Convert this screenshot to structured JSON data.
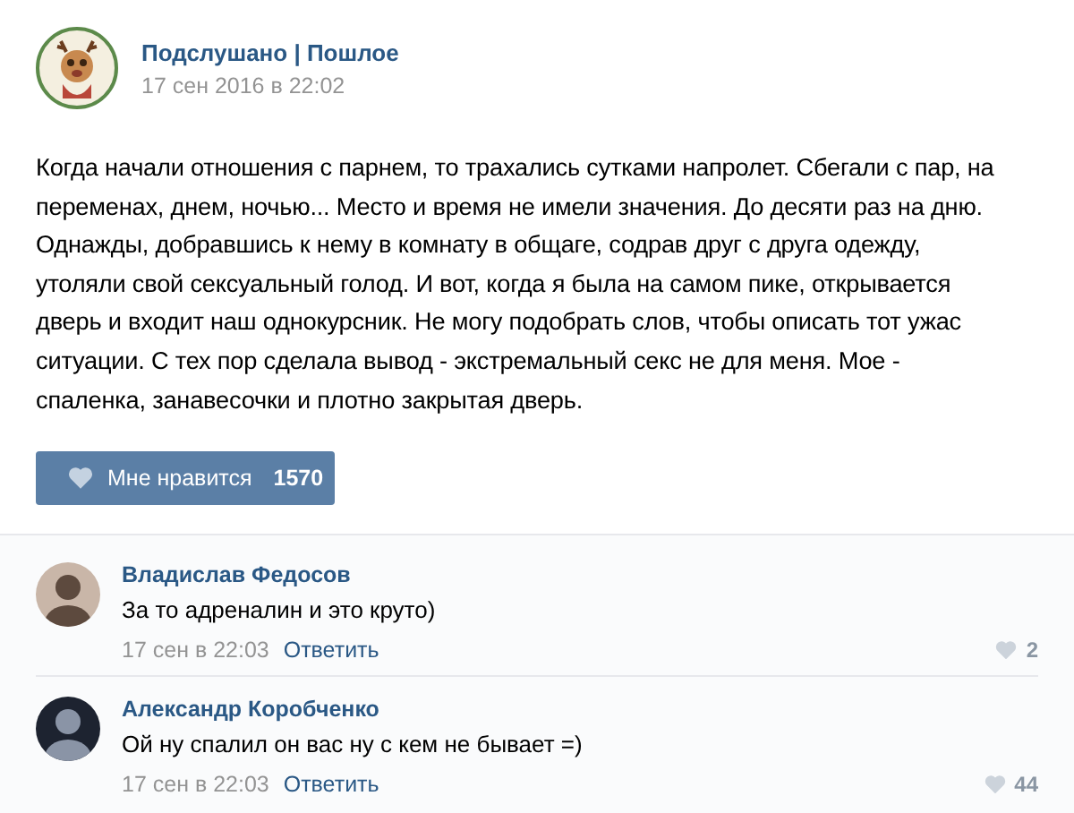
{
  "post": {
    "author": "Подслушано | Пошлое",
    "date": "17 сен 2016 в 22:02",
    "text": "Когда начали отношения с парнем, то трахались сутками напролет. Сбегали с пар, на\nпеременах, днем, ночью... Место и время не имели значения. До десяти раз на дню.\nОднажды, добравшись к нему в комнату в общаге, содрав друг с друга одежду,\nутоляли свой сексуальный голод. И вот, когда я была на самом пике, открывается\nдверь и входит наш однокурсник. Не могу подобрать слов, чтобы описать тот ужас\nситуации. С тех пор сделала вывод - экстремальный секс не для меня. Мое -\nспаленка, занавесочки и плотно закрытая дверь.",
    "like": {
      "label": "Мне нравится",
      "count": "1570"
    }
  },
  "comments": [
    {
      "author": "Владислав Федосов",
      "text": "За то адреналин и это круто)",
      "date": "17 сен в 22:03",
      "reply": "Ответить",
      "likes": "2"
    },
    {
      "author": "Александр Коробченко",
      "text": "Ой ну спалил он вас ну с кем не бывает =)",
      "date": "17 сен в 22:03",
      "reply": "Ответить",
      "likes": "44"
    }
  ]
}
